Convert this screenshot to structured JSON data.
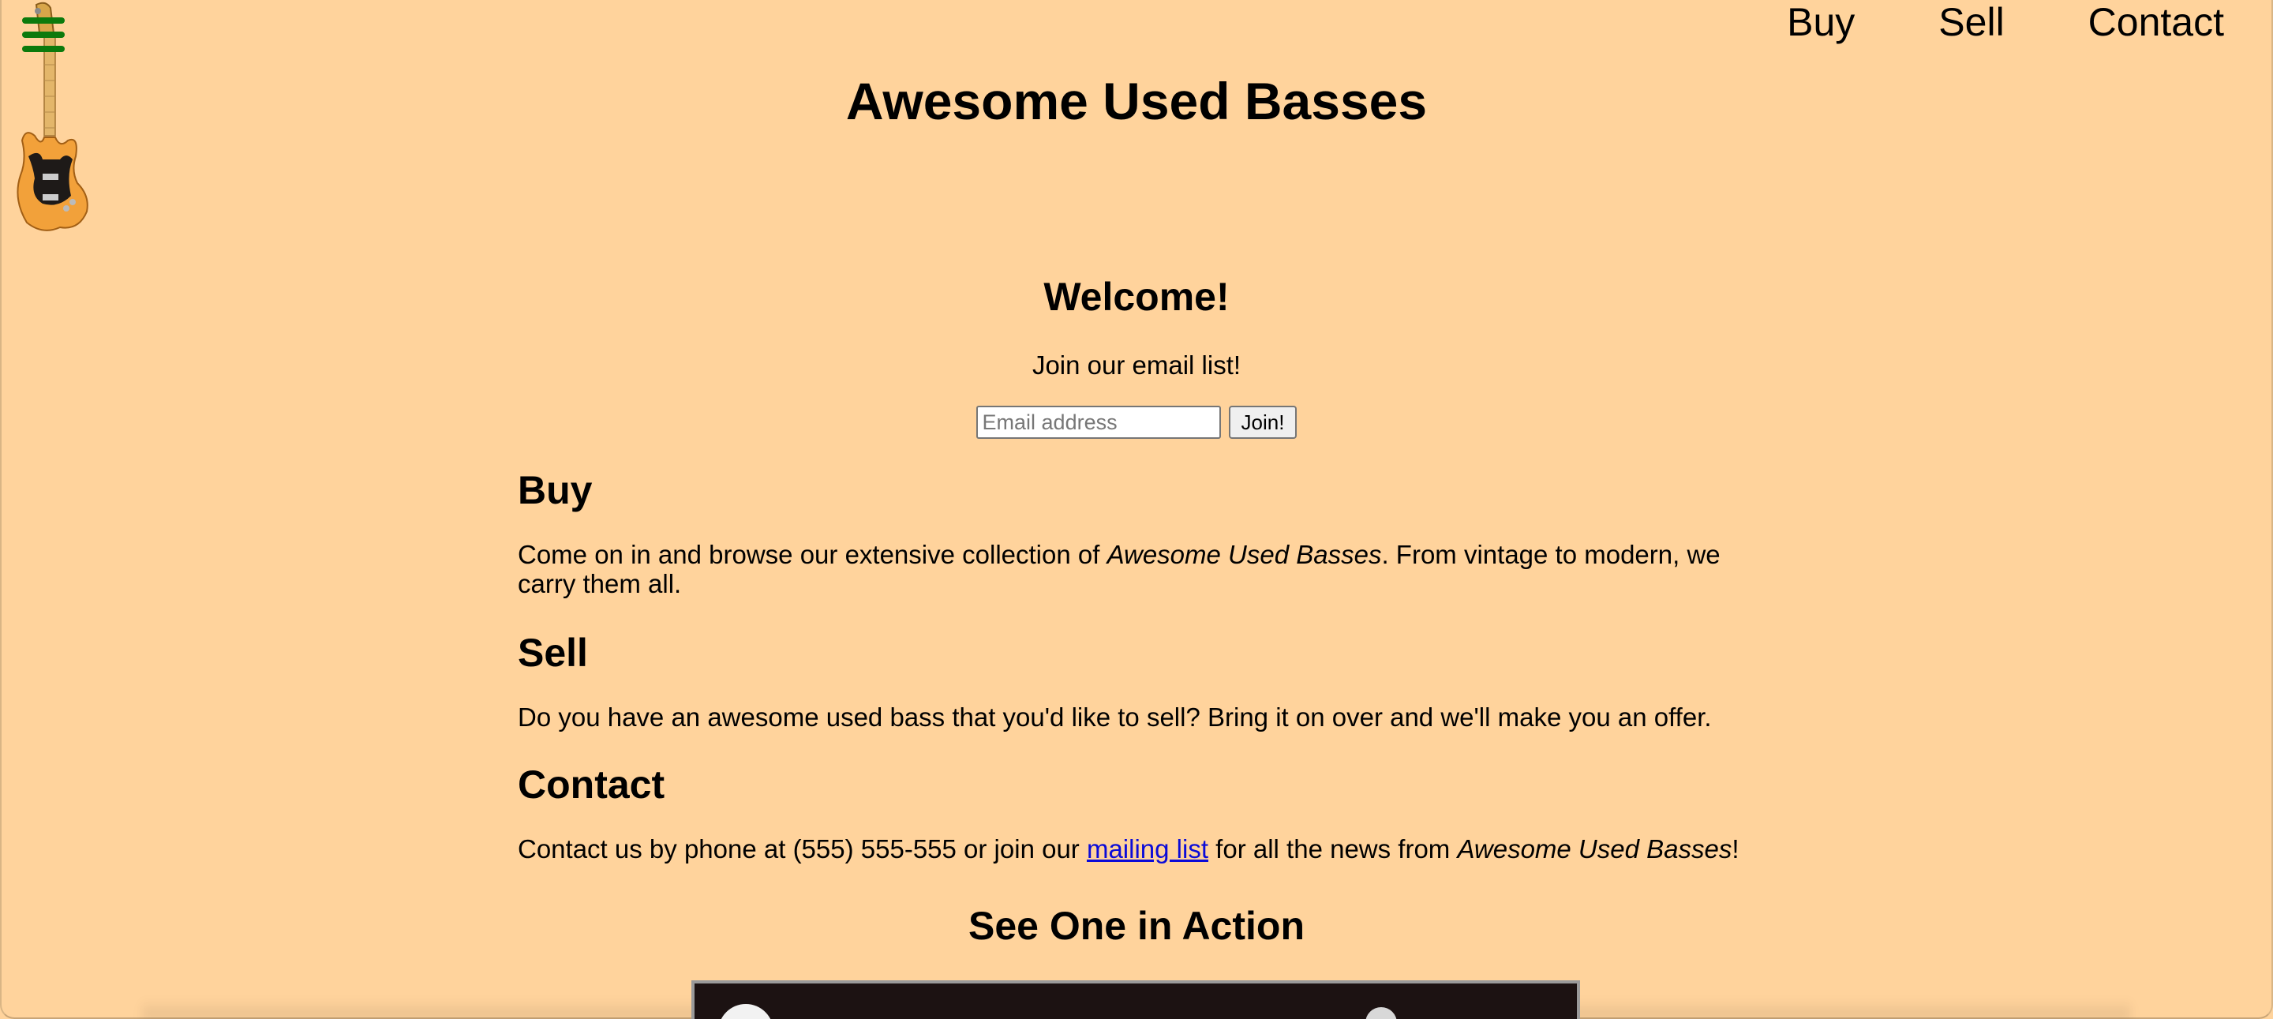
{
  "nav": {
    "items": [
      {
        "label": "Buy"
      },
      {
        "label": "Sell"
      },
      {
        "label": "Contact"
      }
    ]
  },
  "header": {
    "title": "Awesome Used Basses"
  },
  "welcome": {
    "heading": "Welcome!",
    "join_text": "Join our email list!",
    "email_placeholder": "Email address",
    "email_value": "",
    "join_button": "Join!"
  },
  "sections": {
    "buy": {
      "heading": "Buy",
      "text_before": "Come on in and browse our extensive collection of ",
      "text_em": "Awesome Used Basses",
      "text_after": ". From vintage to modern, we carry them all."
    },
    "sell": {
      "heading": "Sell",
      "text": "Do you have an awesome used bass that you'd like to sell? Bring it on over and we'll make you an offer."
    },
    "contact": {
      "heading": "Contact",
      "text_before": "Contact us by phone at (555) 555-555 or join our ",
      "link_text": "mailing list",
      "text_middle": " for all the news from ",
      "text_em": "Awesome Used Basses",
      "text_after": "!"
    }
  },
  "video_section": {
    "heading": "See One in Action"
  },
  "colors": {
    "background": "#ffd39c",
    "hamburger": "#0c7a0c",
    "link": "#0b0bd8"
  },
  "icons": {
    "menu": "hamburger-menu-icon",
    "logo": "bass-guitar-icon"
  }
}
